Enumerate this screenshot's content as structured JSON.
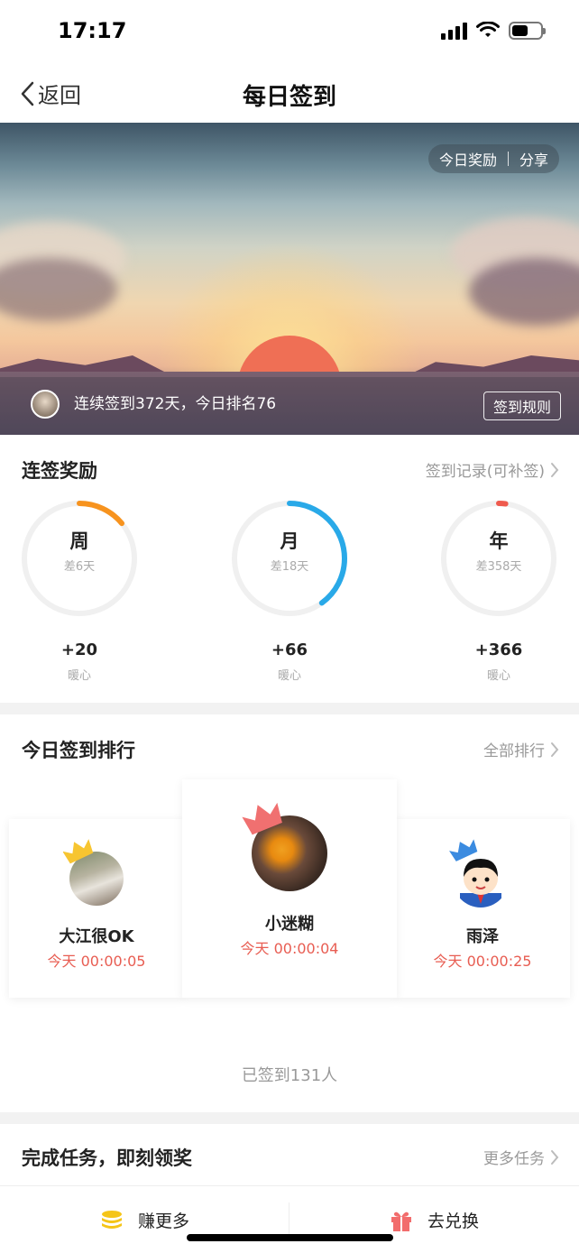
{
  "status_bar": {
    "time": "17:17"
  },
  "nav": {
    "back_label": "返回",
    "title": "每日签到"
  },
  "banner": {
    "today_reward_label": "今日奖励",
    "share_label": "分享",
    "streak_text": "连续签到372天，今日排名76",
    "rules_label": "签到规则"
  },
  "rewards": {
    "title": "连签奖励",
    "records_link": "签到记录(可补签)",
    "items": [
      {
        "period": "周",
        "remaining": "差6天",
        "reward": "+20",
        "unit": "暖心",
        "progress": 0.14,
        "color": "#f7931e"
      },
      {
        "period": "月",
        "remaining": "差18天",
        "reward": "+66",
        "unit": "暖心",
        "progress": 0.4,
        "color": "#29a9e8"
      },
      {
        "period": "年",
        "remaining": "差358天",
        "reward": "+366",
        "unit": "暖心",
        "progress": 0.02,
        "color": "#ef5a4d"
      }
    ]
  },
  "ranking": {
    "title": "今日签到排行",
    "all_link": "全部排行",
    "first": {
      "name": "小迷糊",
      "time": "今天 00:00:04"
    },
    "second": {
      "name": "大江很OK",
      "time": "今天 00:00:05"
    },
    "third": {
      "name": "雨泽",
      "time": "今天 00:00:25"
    },
    "signed_count": "已签到131人"
  },
  "tasks": {
    "title": "完成任务，即刻领奖",
    "more_link": "更多任务",
    "earn_more": "赚更多",
    "exchange": "去兑换"
  },
  "colors": {
    "accent_red": "#e85d52",
    "coin_yellow": "#f5c518",
    "gift_red": "#f26d6d"
  }
}
